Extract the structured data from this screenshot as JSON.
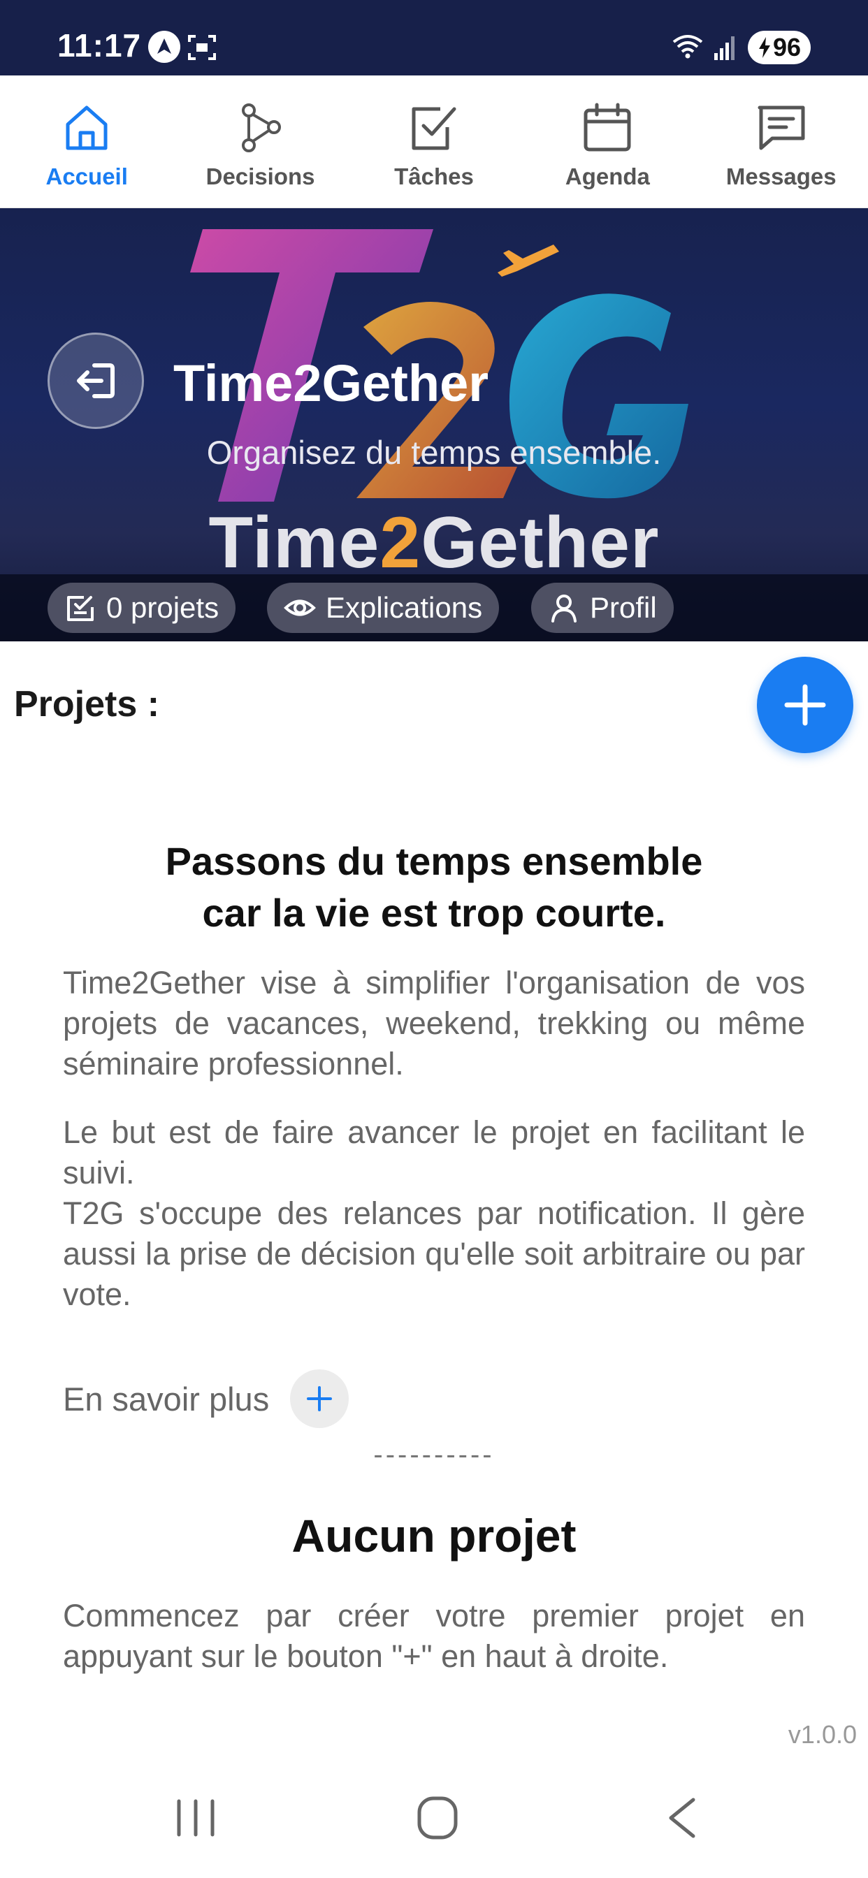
{
  "status_bar": {
    "time": "11:17",
    "battery": "96"
  },
  "nav": {
    "items": [
      {
        "label": "Accueil",
        "icon": "home-icon",
        "active": true
      },
      {
        "label": "Decisions",
        "icon": "decisions-icon",
        "active": false
      },
      {
        "label": "Tâches",
        "icon": "tasks-icon",
        "active": false
      },
      {
        "label": "Agenda",
        "icon": "calendar-icon",
        "active": false
      },
      {
        "label": "Messages",
        "icon": "messages-icon",
        "active": false
      }
    ]
  },
  "banner": {
    "title": "Time2Gether",
    "subtitle": "Organisez du temps ensemble.",
    "brand_left": "Time",
    "brand_mid": "2",
    "brand_right": "Gether",
    "logo_text": "T2G",
    "chips": {
      "projects": "0 projets",
      "explanations": "Explications",
      "profile": "Profil"
    }
  },
  "main": {
    "projects_title": "Projets :",
    "headline_line1": "Passons du temps ensemble",
    "headline_line2": "car la vie est trop courte.",
    "paragraph1": "Time2Gether vise à simplifier l'organisation de vos projets de vacances, weekend, trekking ou même séminaire professionnel.",
    "paragraph2_line1": "Le but est de faire avancer le projet en facilitant le suivi.",
    "paragraph2_line2": "T2G s'occupe des relances par notification. Il gère aussi la prise de décision qu'elle soit arbitraire ou par vote.",
    "learn_more": "En savoir plus",
    "divider": "----------",
    "empty_title": "Aucun projet",
    "empty_text": "Commencez par créer votre premier projet en appuyant sur le bouton \"+\" en haut à droite.",
    "version": "v1.0.0"
  },
  "colors": {
    "accent": "#1a7df2",
    "status_bar": "#17204a",
    "banner_dark": "#141b3a"
  }
}
